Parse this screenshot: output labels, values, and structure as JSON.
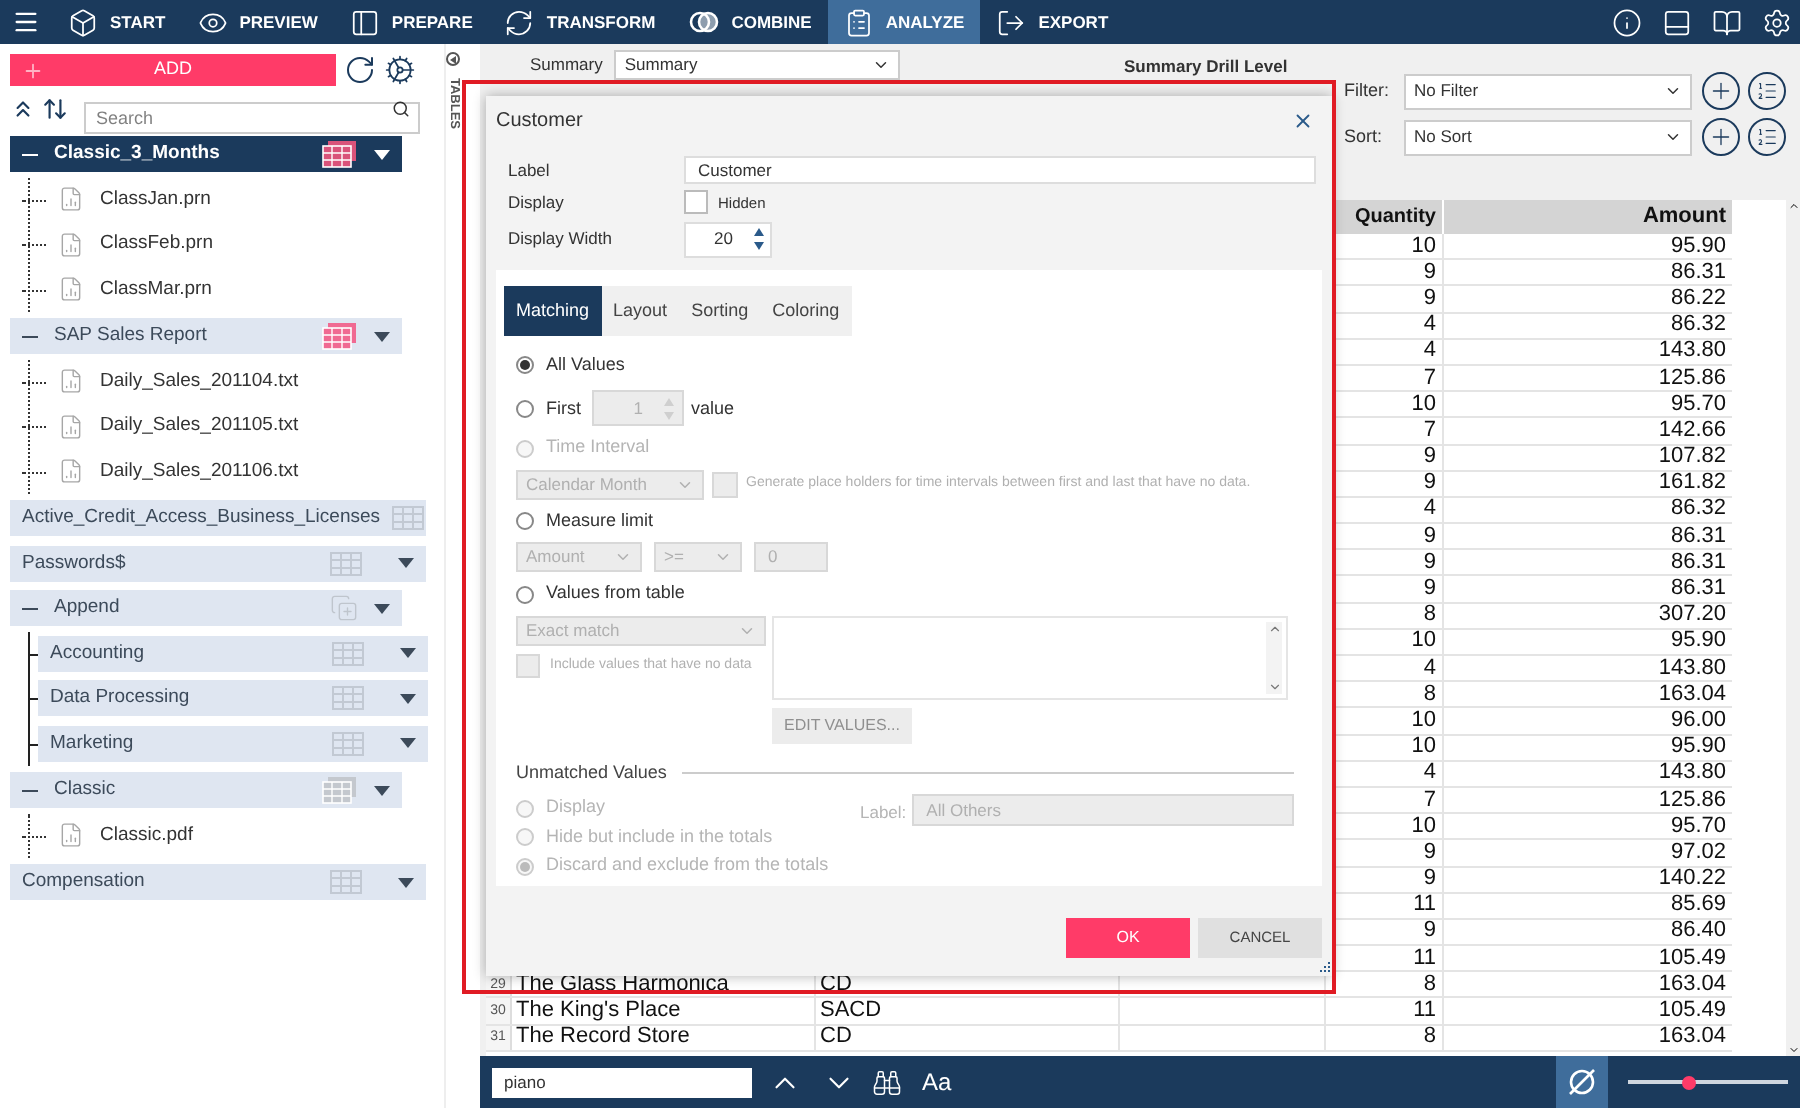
{
  "nav": {
    "items": [
      {
        "label": "START",
        "selected": false
      },
      {
        "label": "PREVIEW",
        "selected": false
      },
      {
        "label": "PREPARE",
        "selected": false
      },
      {
        "label": "TRANSFORM",
        "selected": false
      },
      {
        "label": "COMBINE",
        "selected": false
      },
      {
        "label": "ANALYZE",
        "selected": true
      },
      {
        "label": "EXPORT",
        "selected": false
      }
    ]
  },
  "sidebar": {
    "add_button": "ADD",
    "search": {
      "placeholder": "Search"
    },
    "vertical_tab": "TABLES",
    "items": [
      {
        "kind": "stack",
        "label": "Classic_3_Months",
        "expanded": true,
        "selected": true,
        "color": "#d9537a",
        "children": [
          {
            "kind": "file",
            "label": "ClassJan.prn"
          },
          {
            "kind": "file",
            "label": "ClassFeb.prn"
          },
          {
            "kind": "file",
            "label": "ClassMar.prn"
          }
        ]
      },
      {
        "kind": "stack",
        "label": "SAP Sales Report",
        "expanded": true,
        "selected": false,
        "color": "#f06a92",
        "children": [
          {
            "kind": "file",
            "label": "Daily_Sales_201104.txt"
          },
          {
            "kind": "file",
            "label": "Daily_Sales_201105.txt"
          },
          {
            "kind": "file",
            "label": "Daily_Sales_201106.txt"
          }
        ]
      },
      {
        "kind": "table",
        "label": "Active_Credit_Access_Business_Licenses",
        "selected": false
      },
      {
        "kind": "table",
        "label": "Passwords$",
        "selected": false
      },
      {
        "kind": "append",
        "label": "Append",
        "expanded": true,
        "selected": false,
        "children": [
          {
            "kind": "table",
            "label": "Accounting"
          },
          {
            "kind": "table",
            "label": "Data Processing"
          },
          {
            "kind": "table",
            "label": "Marketing"
          }
        ]
      },
      {
        "kind": "stack",
        "label": "Classic",
        "expanded": true,
        "selected": false,
        "color": "#c4c8ce",
        "children": [
          {
            "kind": "file",
            "label": "Classic.pdf"
          }
        ]
      },
      {
        "kind": "table",
        "label": "Compensation",
        "selected": false
      }
    ]
  },
  "toolbar": {
    "summary_label": "Summary",
    "summary_value": "Summary",
    "drill_label": "Summary Drill Level",
    "filter_label": "Filter:",
    "filter_value": "No Filter",
    "sort_label": "Sort:",
    "sort_value": "No Sort"
  },
  "table": {
    "columns": [
      {
        "label": "Quantity"
      },
      {
        "label": "Amount"
      }
    ],
    "rows": [
      {
        "quantity": "10",
        "amount": "95.90"
      },
      {
        "quantity": "9",
        "amount": "86.31"
      },
      {
        "quantity": "9",
        "amount": "86.22"
      },
      {
        "quantity": "4",
        "amount": "86.32"
      },
      {
        "quantity": "4",
        "amount": "143.80"
      },
      {
        "quantity": "7",
        "amount": "125.86"
      },
      {
        "quantity": "10",
        "amount": "95.70"
      },
      {
        "quantity": "7",
        "amount": "142.66"
      },
      {
        "quantity": "9",
        "amount": "107.82"
      },
      {
        "quantity": "9",
        "amount": "161.82"
      },
      {
        "quantity": "4",
        "amount": "86.32"
      },
      {
        "quantity": "9",
        "amount": "86.31"
      },
      {
        "quantity": "9",
        "amount": "86.31"
      },
      {
        "quantity": "9",
        "amount": "86.31"
      },
      {
        "quantity": "8",
        "amount": "307.20"
      },
      {
        "quantity": "10",
        "amount": "95.90"
      },
      {
        "quantity": "4",
        "amount": "143.80"
      },
      {
        "quantity": "8",
        "amount": "163.04"
      },
      {
        "quantity": "10",
        "amount": "96.00"
      },
      {
        "quantity": "10",
        "amount": "95.90"
      },
      {
        "quantity": "4",
        "amount": "143.80"
      },
      {
        "quantity": "7",
        "amount": "125.86"
      },
      {
        "quantity": "10",
        "amount": "95.70"
      },
      {
        "quantity": "9",
        "amount": "97.02"
      },
      {
        "quantity": "9",
        "amount": "140.22"
      },
      {
        "quantity": "11",
        "amount": "85.69"
      },
      {
        "quantity": "9",
        "amount": "86.40"
      },
      {
        "quantity": "11",
        "amount": "105.49"
      },
      {
        "number": "29",
        "customer": "The Glass Harmonica",
        "format": "CD",
        "quantity": "8",
        "amount": "163.04"
      },
      {
        "number": "30",
        "customer": "The King's Place",
        "format": "SACD",
        "quantity": "11",
        "amount": "105.49"
      },
      {
        "number": "31",
        "customer": "The Record Store",
        "format": "CD",
        "quantity": "8",
        "amount": "163.04"
      }
    ]
  },
  "dialog": {
    "title": "Customer",
    "label_field": {
      "label": "Label",
      "value": "Customer"
    },
    "display": {
      "label": "Display",
      "option": "Hidden",
      "checked": false
    },
    "display_width": {
      "label": "Display Width",
      "value": "20"
    },
    "tabs": [
      {
        "label": "Matching",
        "selected": true
      },
      {
        "label": "Layout",
        "selected": false
      },
      {
        "label": "Sorting",
        "selected": false
      },
      {
        "label": "Coloring",
        "selected": false
      }
    ],
    "matching": {
      "all_values": {
        "label": "All Values",
        "selected": true,
        "disabled": false
      },
      "first": {
        "label": "First",
        "selected": false,
        "disabled": false,
        "value": "1",
        "suffix": "value",
        "inputs_disabled": true
      },
      "time_interval": {
        "label": "Time Interval",
        "selected": false,
        "disabled": true,
        "period": "Calendar Month",
        "checked": false,
        "note": "Generate place holders for time intervals between first and last that have no data.",
        "inputs_disabled": true
      },
      "measure_limit": {
        "label": "Measure limit",
        "selected": false,
        "disabled": false,
        "measure": "Amount",
        "operator": ">=",
        "value": "0",
        "inputs_disabled": true
      },
      "values_from_table": {
        "label": "Values from table",
        "selected": false,
        "disabled": false,
        "mode": "Exact match",
        "include_label": "Include values that have no data",
        "checked": false,
        "edit_button": "EDIT VALUES...",
        "inputs_disabled": true
      }
    },
    "unmatched": {
      "title": "Unmatched Values",
      "options": [
        {
          "label": "Display",
          "selected": false,
          "disabled": true
        },
        {
          "label": "Hide but include in the totals",
          "selected": false,
          "disabled": true
        },
        {
          "label": "Discard and exclude from the totals",
          "selected": true,
          "disabled": true
        }
      ],
      "label_caption": "Label:",
      "label_value": "All Others",
      "label_disabled": true
    },
    "ok": "OK",
    "cancel": "CANCEL"
  },
  "find_bar": {
    "value": "piano",
    "case_label": "Aa",
    "null_toggle": {
      "on": true
    },
    "zoom": {
      "level": 0.38
    }
  }
}
